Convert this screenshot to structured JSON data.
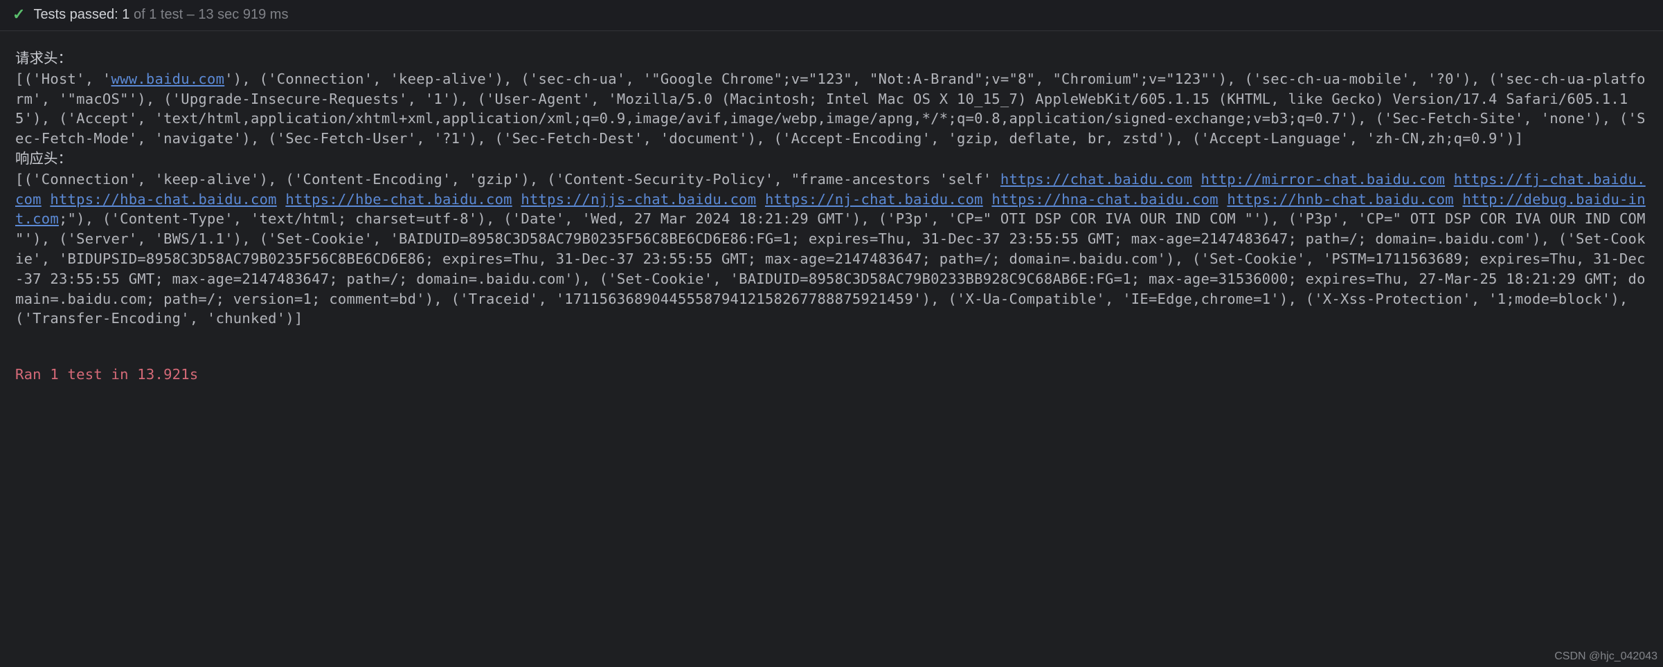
{
  "status": {
    "prefix": "Tests passed:",
    "count": "1",
    "suffix": "of 1 test – 13 sec 919 ms"
  },
  "labels": {
    "request": "请求头：",
    "response": "响应头："
  },
  "req": {
    "p1": "[('Host', '",
    "host_url": "www.baidu.com",
    "p2": "'), ('Connection', 'keep-alive'), ('sec-ch-ua', '\"Google Chrome\";v=\"123\", \"Not:A-Brand\";v=\"8\", \"Chromium\";v=\"123\"'), ('sec-ch-ua-mobile', '?0'), ('sec-ch-ua-platform', '\"macOS\"'), ('Upgrade-Insecure-Requests', '1'), ('User-Agent', 'Mozilla/5.0 (Macintosh; Intel Mac OS X 10_15_7) AppleWebKit/605.1.15 (KHTML, like Gecko) Version/17.4 Safari/605.1.15'), ('Accept', 'text/html,application/xhtml+xml,application/xml;q=0.9,image/avif,image/webp,image/apng,*/*;q=0.8,application/signed-exchange;v=b3;q=0.7'), ('Sec-Fetch-Site', 'none'), ('Sec-Fetch-Mode', 'navigate'), ('Sec-Fetch-User', '?1'), ('Sec-Fetch-Dest', 'document'), ('Accept-Encoding', 'gzip, deflate, br, zstd'), ('Accept-Language', 'zh-CN,zh;q=0.9')]"
  },
  "resp": {
    "p1": "[('Connection', 'keep-alive'), ('Content-Encoding', 'gzip'), ('Content-Security-Policy', \"frame-ancestors 'self' ",
    "u1": "https://chat.baidu.com",
    "u2": "http://mirror-chat.baidu.com",
    "u3": "https://fj-chat.baidu.com",
    "u4": "https://hba-chat.baidu.com",
    "u5": "https://hbe-chat.baidu.com",
    "u6": "https://njjs-chat.baidu.com",
    "u7": "https://nj-chat.baidu.com",
    "u8": "https://hna-chat.baidu.com",
    "u9": "https://hnb-chat.baidu.com",
    "u10": "http://debug.baidu-int.com",
    "tail": ";\"), ('Content-Type', 'text/html; charset=utf-8'), ('Date', 'Wed, 27 Mar 2024 18:21:29 GMT'), ('P3p', 'CP=\" OTI DSP COR IVA OUR IND COM \"'), ('P3p', 'CP=\" OTI DSP COR IVA OUR IND COM \"'), ('Server', 'BWS/1.1'), ('Set-Cookie', 'BAIDUID=8958C3D58AC79B0235F56C8BE6CD6E86:FG=1; expires=Thu, 31-Dec-37 23:55:55 GMT; max-age=2147483647; path=/; domain=.baidu.com'), ('Set-Cookie', 'BIDUPSID=8958C3D58AC79B0235F56C8BE6CD6E86; expires=Thu, 31-Dec-37 23:55:55 GMT; max-age=2147483647; path=/; domain=.baidu.com'), ('Set-Cookie', 'PSTM=1711563689; expires=Thu, 31-Dec-37 23:55:55 GMT; max-age=2147483647; path=/; domain=.baidu.com'), ('Set-Cookie', 'BAIDUID=8958C3D58AC79B0233BB928C9C68AB6E:FG=1; max-age=31536000; expires=Thu, 27-Mar-25 18:21:29 GMT; domain=.baidu.com; path=/; version=1; comment=bd'), ('Traceid', '171156368904455587941215826778887592145​9'), ('X-Ua-Compatible', 'IE=Edge,chrome=1'), ('X-Xss-Protection', '1;mode=block'), ('Transfer-Encoding', 'chunked')]"
  },
  "footer": "Ran 1 test in 13.921s",
  "watermark": "CSDN @hjc_042043"
}
